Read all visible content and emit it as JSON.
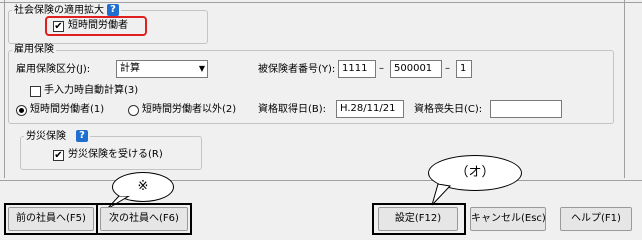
{
  "social_expansion": {
    "legend": "社会保険の適用拡大",
    "help_icon": "?",
    "short_time_label": "短時間労働者",
    "short_time_checked": true,
    "highlight_color": "#e02020"
  },
  "employment": {
    "legend": "雇用保険",
    "category_label": "雇用保険区分(J):",
    "category_value": "計算",
    "insured_no_label": "被保険者番号(Y):",
    "insured_no_1": "1111",
    "insured_no_2": "500001",
    "insured_no_3": "1",
    "dash": "–",
    "manual_calc_label": "手入力時自動計算(3)",
    "radio_short_label": "短時間労働者(1)",
    "radio_other_label": "短時間労働者以外(2)",
    "acquired_label": "資格取得日(B):",
    "acquired_value": "H.28/11/21",
    "lost_label": "資格喪失日(C):",
    "lost_value": ""
  },
  "workers_comp": {
    "legend": "労災保険",
    "help_icon": "?",
    "receive_label": "労災保険を受ける(R)",
    "receive_checked": true
  },
  "buttons": {
    "prev": "前の社員へ(F5)",
    "next": "次の社員へ(F6)",
    "save": "設定(F12)",
    "cancel": "キャンセル(Esc)",
    "help": "ヘルプ(F1)"
  },
  "annotations": {
    "note_mark": "※",
    "o_mark": "（オ）"
  }
}
